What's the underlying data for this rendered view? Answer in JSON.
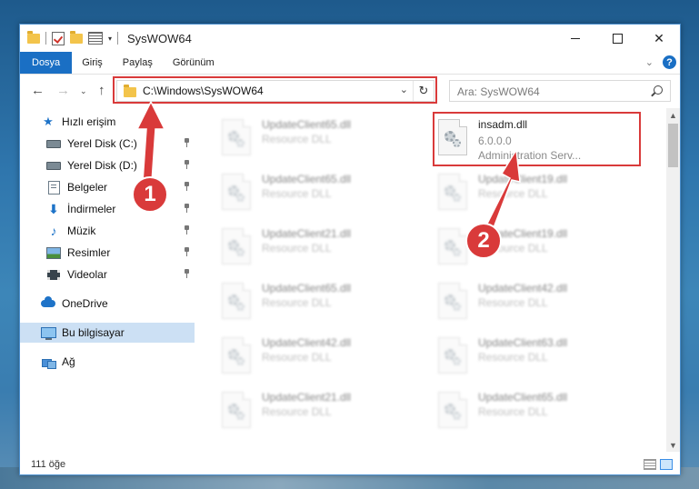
{
  "window": {
    "title": "SysWOW64",
    "controls": {
      "minimize": "",
      "maximize": "",
      "close": "✕"
    }
  },
  "ribbon": {
    "tabs": [
      "Dosya",
      "Giriş",
      "Paylaş",
      "Görünüm"
    ],
    "help": "?"
  },
  "nav": {
    "address": "C:\\Windows\\SysWOW64",
    "search_placeholder": "Ara: SysWOW64"
  },
  "sidebar": {
    "quick_access": "Hızlı erişim",
    "items": [
      {
        "label": "Yerel Disk (C:)",
        "icon": "drive-icon"
      },
      {
        "label": "Yerel Disk (D:)",
        "icon": "drive-icon"
      },
      {
        "label": "Belgeler",
        "icon": "documents-icon"
      },
      {
        "label": "İndirmeler",
        "icon": "downloads-icon"
      },
      {
        "label": "Müzik",
        "icon": "music-icon"
      },
      {
        "label": "Resimler",
        "icon": "pictures-icon"
      },
      {
        "label": "Videolar",
        "icon": "videos-icon"
      }
    ],
    "onedrive": "OneDrive",
    "this_pc": "Bu bilgisayar",
    "network": "Ağ"
  },
  "files": {
    "left": [
      {
        "name": "UpdateClient65.dll",
        "type": "Resource DLL"
      },
      {
        "name": "UpdateClient65.dll",
        "type": "Resource DLL"
      },
      {
        "name": "UpdateClient21.dll",
        "type": "Resource DLL"
      },
      {
        "name": "UpdateClient65.dll",
        "type": "Resource DLL"
      },
      {
        "name": "UpdateClient42.dll",
        "type": "Resource DLL"
      },
      {
        "name": "UpdateClient21.dll",
        "type": "Resource DLL"
      }
    ],
    "right": [
      {
        "name": "insadm.dll",
        "version": "6.0.0.0",
        "type": "Administration Serv..."
      },
      {
        "name": "UpdateClient19.dll",
        "type": "Resource DLL"
      },
      {
        "name": "UpdateClient19.dll",
        "type": "Resource DLL"
      },
      {
        "name": "UpdateClient42.dll",
        "type": "Resource DLL"
      },
      {
        "name": "UpdateClient63.dll",
        "type": "Resource DLL"
      },
      {
        "name": "UpdateClient65.dll",
        "type": "Resource DLL"
      }
    ]
  },
  "status": {
    "count": "111 öğe"
  },
  "callouts": {
    "one": "1",
    "two": "2"
  },
  "colors": {
    "accent": "#1a6fc4",
    "highlight": "#d93a3a",
    "selected": "#cce0f4"
  }
}
